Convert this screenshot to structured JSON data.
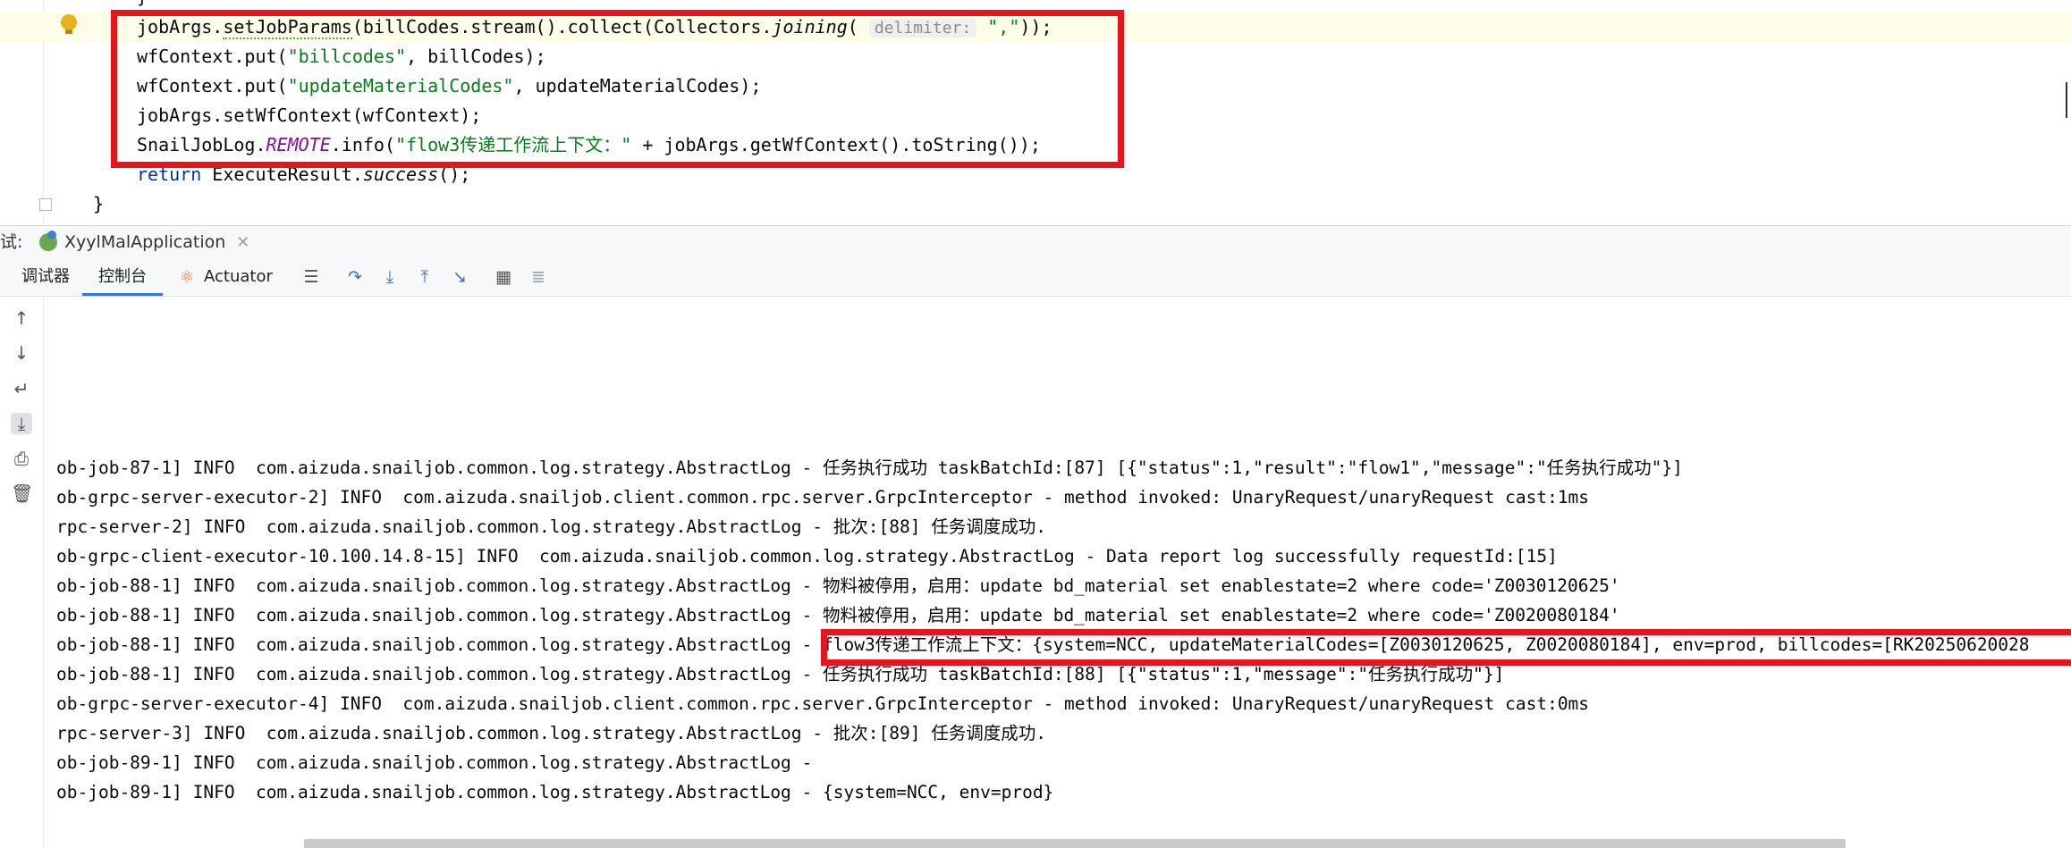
{
  "editor": {
    "lines": [
      {
        "parts": [
          [
            "jobArgs.",
            ""
          ],
          [
            "setJobParams",
            "dotted"
          ],
          [
            "(billCodes.stream().",
            ""
          ],
          [
            "collect",
            ""
          ],
          [
            "(Collectors.",
            ""
          ],
          [
            "joining",
            "fn"
          ],
          [
            "( ",
            ""
          ],
          [
            "delimiter:",
            "hint"
          ],
          [
            " ",
            ""
          ],
          [
            "\",\"",
            "str"
          ],
          [
            "));",
            ""
          ]
        ]
      },
      {
        "parts": [
          [
            "wfContext.put(",
            ""
          ],
          [
            "\"billcodes\"",
            "str"
          ],
          [
            ", billCodes);",
            ""
          ]
        ]
      },
      {
        "parts": [
          [
            "wfContext.put(",
            ""
          ],
          [
            "\"updateMaterialCodes\"",
            "str"
          ],
          [
            ", updateMaterialCodes);",
            ""
          ]
        ]
      },
      {
        "parts": [
          [
            "jobArgs.setWfContext(wfContext);",
            ""
          ]
        ]
      },
      {
        "parts": [
          [
            "SnailJobLog.",
            ""
          ],
          [
            "REMOTE",
            "purple"
          ],
          [
            ".info(",
            ""
          ],
          [
            "\"flow3传递工作流上下文：\"",
            "str"
          ],
          [
            " + jobArgs.getWfContext().toString());",
            ""
          ]
        ]
      },
      {
        "parts": [
          [
            "return",
            "kw"
          ],
          [
            " ExecuteResult.",
            ""
          ],
          [
            "success",
            "fn"
          ],
          [
            "();",
            ""
          ]
        ]
      }
    ],
    "closing_brace": "}",
    "top_brace": "}"
  },
  "run_window": {
    "label": "试:",
    "tab_title": "XyylMalApplication"
  },
  "toolbar": {
    "debugger_tab": "调试器",
    "console_tab": "控制台",
    "actuator_tab": "Actuator"
  },
  "console": {
    "log_lines": [
      "ob-job-87-1] INFO  com.aizuda.snailjob.common.log.strategy.AbstractLog - 任务执行成功 taskBatchId:[87] [{\"status\":1,\"result\":\"flow1\",\"message\":\"任务执行成功\"}]",
      "ob-grpc-server-executor-2] INFO  com.aizuda.snailjob.client.common.rpc.server.GrpcInterceptor - method invoked: UnaryRequest/unaryRequest cast:1ms",
      "rpc-server-2] INFO  com.aizuda.snailjob.common.log.strategy.AbstractLog - 批次:[88] 任务调度成功.",
      "ob-grpc-client-executor-10.100.14.8-15] INFO  com.aizuda.snailjob.common.log.strategy.AbstractLog - Data report log successfully requestId:[15]",
      "ob-job-88-1] INFO  com.aizuda.snailjob.common.log.strategy.AbstractLog - 物料被停用，启用：update bd_material set enablestate=2 where code='Z0030120625'",
      "ob-job-88-1] INFO  com.aizuda.snailjob.common.log.strategy.AbstractLog - 物料被停用，启用：update bd_material set enablestate=2 where code='Z0020080184'",
      "ob-job-88-1] INFO  com.aizuda.snailjob.common.log.strategy.AbstractLog - flow3传递工作流上下文：{system=NCC, updateMaterialCodes=[Z0030120625, Z0020080184], env=prod, billcodes=[RK20250620028",
      "ob-job-88-1] INFO  com.aizuda.snailjob.common.log.strategy.AbstractLog - 任务执行成功 taskBatchId:[88] [{\"status\":1,\"message\":\"任务执行成功\"}]",
      "ob-grpc-server-executor-4] INFO  com.aizuda.snailjob.client.common.rpc.server.GrpcInterceptor - method invoked: UnaryRequest/unaryRequest cast:0ms",
      "rpc-server-3] INFO  com.aizuda.snailjob.common.log.strategy.AbstractLog - 批次:[89] 任务调度成功.",
      "ob-job-89-1] INFO  com.aizuda.snailjob.common.log.strategy.AbstractLog - ",
      "ob-job-89-1] INFO  com.aizuda.snailjob.common.log.strategy.AbstractLog - {system=NCC, env=prod}"
    ]
  },
  "icons": {
    "toolbar": [
      "actuator-icon",
      "menu-icon",
      "step-over-icon",
      "step-into-icon",
      "step-out-icon",
      "run-to-cursor-icon",
      "evaluate-icon",
      "trace-icon"
    ],
    "side": [
      "up-arrow-icon",
      "down-arrow-icon",
      "soft-wrap-icon",
      "scroll-to-end-icon",
      "print-icon",
      "trash-icon"
    ]
  },
  "colors": {
    "annotation_red": "#e8141c",
    "string_green": "#067d17",
    "keyword_blue": "#0033b3",
    "tab_active": "#3574f0"
  }
}
